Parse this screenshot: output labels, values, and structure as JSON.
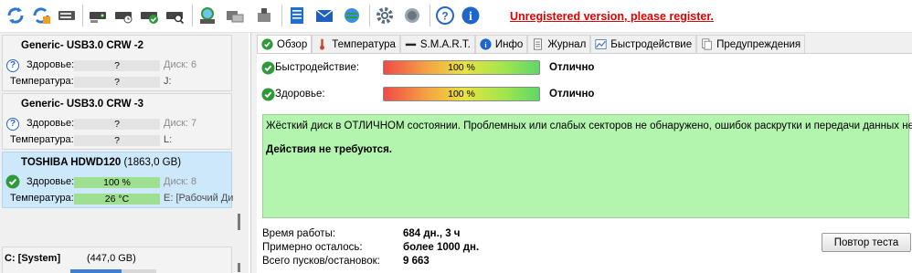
{
  "toolbar": {
    "buttons": [
      {
        "icon": "refresh-icon"
      },
      {
        "icon": "refresh-all-icon"
      },
      {
        "icon": "disk-info-icon"
      },
      {
        "icon": "disk-settings-icon"
      },
      {
        "icon": "disk-timer-icon"
      },
      {
        "icon": "disk-check-icon"
      },
      {
        "icon": "disk-search-icon"
      },
      {
        "icon": "network-disk-icon"
      },
      {
        "icon": "disk-copy-icon"
      },
      {
        "icon": "disk-remove-icon"
      },
      {
        "icon": "notes-icon"
      },
      {
        "icon": "mail-icon"
      },
      {
        "icon": "network-icon"
      },
      {
        "icon": "gear-icon"
      },
      {
        "icon": "sound-icon"
      },
      {
        "icon": "help-icon"
      },
      {
        "icon": "info-icon"
      }
    ],
    "unregistered_text": "Unregistered version, please register."
  },
  "disks": [
    {
      "name": "Generic- USB3.0 CRW   -2",
      "size": "",
      "health_label": "Здоровье:",
      "health_value": "?",
      "side1": "Диск: 6",
      "temp_label": "Температура:",
      "temp_value": "?",
      "side2": "J:",
      "status": "unknown"
    },
    {
      "name": "Generic- USB3.0 CRW   -3",
      "size": "",
      "health_label": "Здоровье:",
      "health_value": "?",
      "side1": "Диск: 7",
      "temp_label": "Температура:",
      "temp_value": "?",
      "side2": "L:",
      "status": "unknown"
    },
    {
      "name": "TOSHIBA HDWD120",
      "size": "(1863,0 GB)",
      "health_label": "Здоровье:",
      "health_value": "100 %",
      "side1": "Диск: 8",
      "temp_label": "Температура:",
      "temp_value": "26 °C",
      "side2": "E: [Рабочий Ди",
      "status": "ok"
    }
  ],
  "system_volume": {
    "label": "C: [System]",
    "size": "(447,0 GB)"
  },
  "tabs": [
    {
      "label": "Обзор",
      "icon": "check-circle-icon",
      "active": true
    },
    {
      "label": "Температура",
      "icon": "thermometer-icon",
      "active": false
    },
    {
      "label": "S.M.A.R.T.",
      "icon": "smart-icon",
      "active": false
    },
    {
      "label": "Инфо",
      "icon": "info-icon",
      "active": false
    },
    {
      "label": "Журнал",
      "icon": "log-icon",
      "active": false
    },
    {
      "label": "Быстродействие",
      "icon": "chart-icon",
      "active": false
    },
    {
      "label": "Предупреждения",
      "icon": "warnings-icon",
      "active": false
    }
  ],
  "overview": {
    "performance": {
      "label": "Быстродействие:",
      "value": "100 %",
      "percent": 100,
      "verdict": "Отлично"
    },
    "health": {
      "label": "Здоровье:",
      "value": "100 %",
      "percent": 100,
      "verdict": "Отлично"
    },
    "message": "Жёсткий диск в ОТЛИЧНОМ состоянии. Проблемных или слабых секторов не обнаружено, ошибок раскрутки и передачи данных нет.",
    "action": "Действия не требуются.",
    "stats": [
      {
        "label": "Время работы:",
        "value": "684 дн., 3 ч"
      },
      {
        "label": "Примерно осталось:",
        "value": "более 1000 дн."
      },
      {
        "label": "Всего пусков/остановок:",
        "value": "9 663"
      }
    ],
    "retest_button": "Повтор теста"
  },
  "colors": {
    "ok_green": "#2e9a3a",
    "info_box_green": "#b3f5ae",
    "unregistered_red": "#e00000",
    "selected_card": "#cde8fb"
  }
}
